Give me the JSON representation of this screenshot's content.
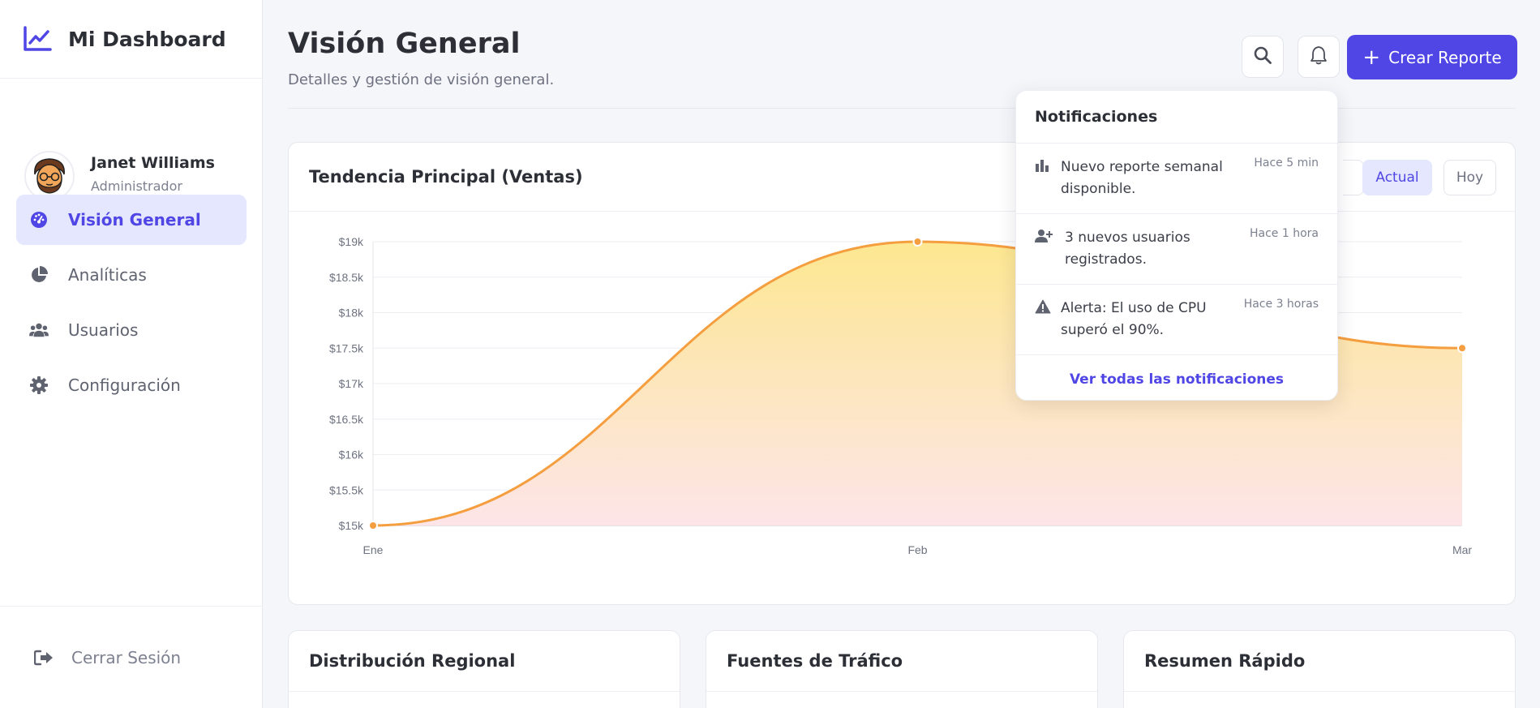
{
  "sidebar": {
    "brand": "Mi Dashboard",
    "profile": {
      "name": "Janet Williams",
      "role": "Administrador"
    },
    "items": [
      {
        "label": "Visión General",
        "icon": "gauge-icon",
        "active": true
      },
      {
        "label": "Analíticas",
        "icon": "pie-chart-icon",
        "active": false
      },
      {
        "label": "Usuarios",
        "icon": "users-icon",
        "active": false
      },
      {
        "label": "Configuración",
        "icon": "gear-icon",
        "active": false
      }
    ],
    "logout": "Cerrar Sesión"
  },
  "header": {
    "title": "Visión General",
    "subtitle": "Detalles y gestión de visión general.",
    "create_label": "Crear Reporte"
  },
  "chart_card": {
    "title": "Tendencia Principal (Ventas)",
    "filters": [
      "Actual",
      "Hoy"
    ],
    "active_filter": "Actual"
  },
  "chart_data": {
    "type": "area",
    "categories": [
      "Ene",
      "Feb",
      "Mar"
    ],
    "values": [
      15000,
      19000,
      17500
    ],
    "ylim": [
      15000,
      19000
    ],
    "yticks": [
      "$15k",
      "$15.5k",
      "$16k",
      "$16.5k",
      "$17k",
      "$17.5k",
      "$18k",
      "$18.5k",
      "$19k"
    ],
    "grid": true,
    "line_color": "#f59e3f",
    "fill_top": "#fde68a",
    "fill_bottom": "#fde2e6"
  },
  "bottom_cards": [
    "Distribución Regional",
    "Fuentes de Tráfico",
    "Resumen Rápido"
  ],
  "notifications": {
    "title": "Notificaciones",
    "items": [
      {
        "icon": "bar-chart-icon",
        "text": "Nuevo reporte semanal disponible.",
        "time": "Hace 5 min"
      },
      {
        "icon": "user-plus-icon",
        "text": "3 nuevos usuarios registrados.",
        "time": "Hace 1 hora"
      },
      {
        "icon": "warning-icon",
        "text": "Alerta: El uso de CPU superó el 90%.",
        "time": "Hace 3 horas"
      }
    ],
    "footer": "Ver todas las notificaciones"
  },
  "colors": {
    "accent": "#4f46e5",
    "accent_soft": "#e4e7fd"
  }
}
